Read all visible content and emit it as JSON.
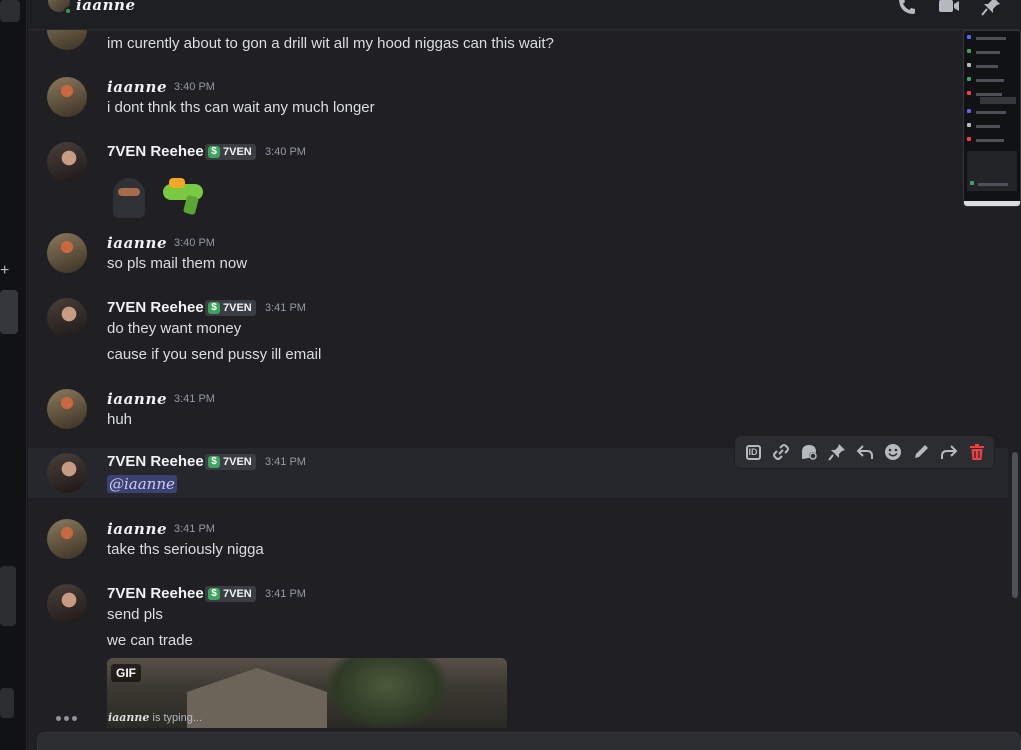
{
  "header": {
    "username": "iaanne",
    "icons": [
      "phone-call-icon",
      "video-call-icon",
      "pin-icon"
    ]
  },
  "messages": [
    {
      "id": "m0",
      "author": "iaanne",
      "continued_line": "im curently about to gon a drill wit all my hood niggas can this wait?"
    },
    {
      "id": "m1",
      "author": "iaanne",
      "time": "3:40 PM",
      "lines": [
        "i dont thnk ths can wait any much longer"
      ]
    },
    {
      "id": "m2",
      "author": "7VEN Reehee",
      "tag": "7VEN",
      "time": "3:40 PM",
      "emojis": [
        "ninja",
        "water-pistol"
      ]
    },
    {
      "id": "m3",
      "author": "iaanne",
      "time": "3:40 PM",
      "lines": [
        "so pls mail them now"
      ]
    },
    {
      "id": "m4",
      "author": "7VEN Reehee",
      "tag": "7VEN",
      "time": "3:41 PM",
      "lines": [
        "do they want money",
        "cause if you send pussy ill email"
      ]
    },
    {
      "id": "m5",
      "author": "iaanne",
      "time": "3:41 PM",
      "lines": [
        "huh"
      ]
    },
    {
      "id": "m6",
      "author": "7VEN Reehee",
      "tag": "7VEN",
      "time": "3:41 PM",
      "mention": "@iaanne"
    },
    {
      "id": "m7",
      "author": "iaanne",
      "time": "3:41 PM",
      "lines": [
        "take ths seriously nigga"
      ]
    },
    {
      "id": "m8",
      "author": "7VEN Reehee",
      "tag": "7VEN",
      "time": "3:41 PM",
      "lines": [
        "send pls",
        "we can trade"
      ],
      "attachment_badge": "GIF"
    }
  ],
  "toolbar": {
    "buttons": [
      "copy-id-icon",
      "copy-link-icon",
      "create-thread-icon",
      "pin-icon",
      "reply-icon",
      "add-reaction-icon",
      "edit-icon",
      "forward-icon",
      "delete-icon"
    ],
    "id_label": "ID"
  },
  "typing": {
    "name": "iaanne",
    "suffix": " is typing..."
  },
  "colors": {
    "accent_green": "#23a55a",
    "danger": "#f23f42",
    "mention_bg": "#3c4270"
  }
}
